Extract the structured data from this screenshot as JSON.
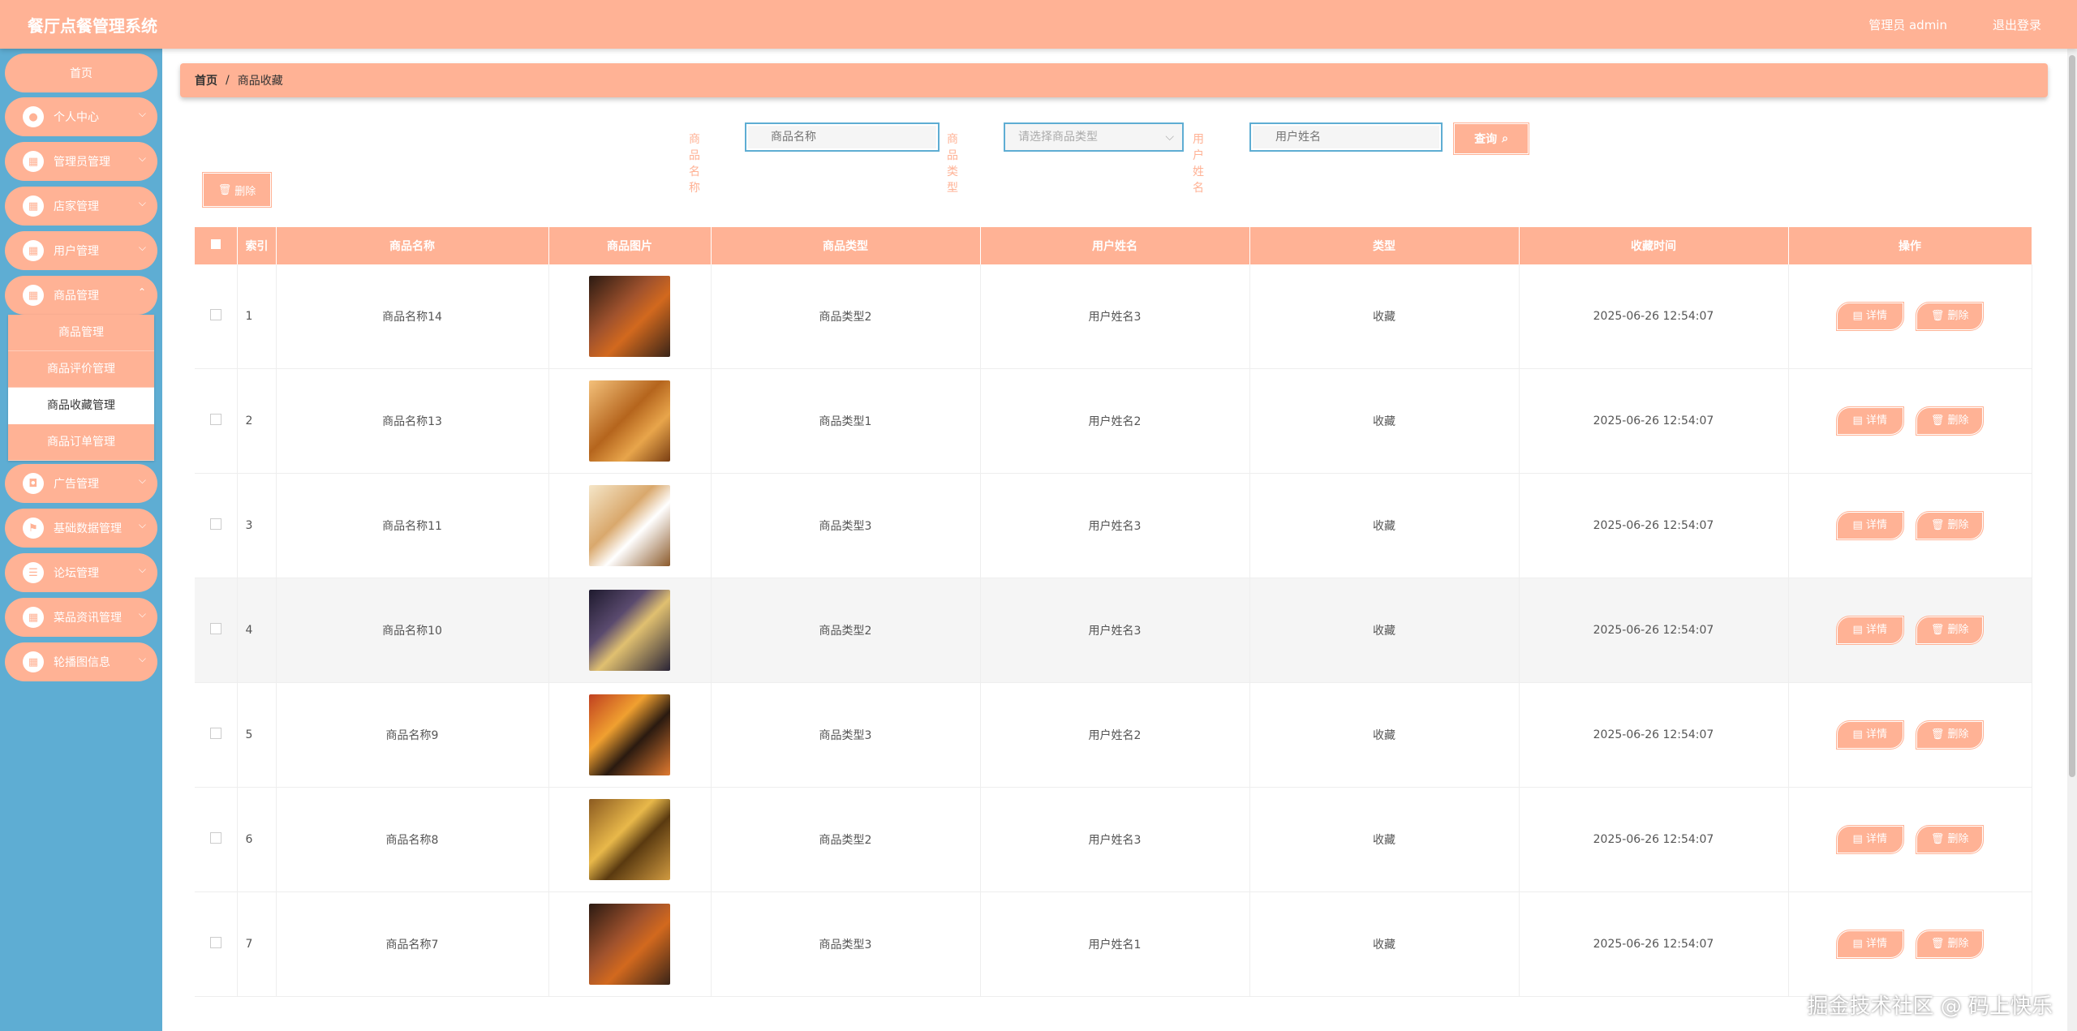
{
  "header": {
    "title": "餐厅点餐管理系统",
    "admin": "管理员 admin",
    "logout": "退出登录"
  },
  "sidebar": {
    "home": "首页",
    "items": [
      {
        "label": "个人中心",
        "icon": "user-icon"
      },
      {
        "label": "管理员管理",
        "icon": "grid-icon"
      },
      {
        "label": "店家管理",
        "icon": "grid-icon"
      },
      {
        "label": "用户管理",
        "icon": "grid-icon"
      },
      {
        "label": "商品管理",
        "icon": "grid-icon"
      },
      {
        "label": "广告管理",
        "icon": "bag-icon"
      },
      {
        "label": "基础数据管理",
        "icon": "flag-icon"
      },
      {
        "label": "论坛管理",
        "icon": "sliders-icon"
      },
      {
        "label": "菜品资讯管理",
        "icon": "grid-icon"
      },
      {
        "label": "轮播图信息",
        "icon": "grid-icon"
      }
    ],
    "submenu": [
      "商品管理",
      "商品评价管理",
      "商品收藏管理",
      "商品订单管理"
    ],
    "submenu_active": "商品收藏管理"
  },
  "breadcrumb": {
    "home": "首页",
    "sep": "/",
    "current": "商品收藏"
  },
  "search": {
    "name_label": "商品名称",
    "name_placeholder": "商品名称",
    "type_label": "商品类型",
    "type_placeholder": "请选择商品类型",
    "user_label": "用户姓名",
    "user_placeholder": "用户姓名",
    "query_label": "查询"
  },
  "toolbar": {
    "delete_label": "删除"
  },
  "table": {
    "headers": [
      "索引",
      "商品名称",
      "商品图片",
      "商品类型",
      "用户姓名",
      "类型",
      "收藏时间",
      "操作"
    ],
    "detail_label": "详情",
    "delete_label": "删除",
    "rows": [
      {
        "idx": "1",
        "name": "商品名称14",
        "type": "商品类型2",
        "user": "用户姓名3",
        "kind": "收藏",
        "time": "2025-06-26 12:54:07"
      },
      {
        "idx": "2",
        "name": "商品名称13",
        "type": "商品类型1",
        "user": "用户姓名2",
        "kind": "收藏",
        "time": "2025-06-26 12:54:07"
      },
      {
        "idx": "3",
        "name": "商品名称11",
        "type": "商品类型3",
        "user": "用户姓名3",
        "kind": "收藏",
        "time": "2025-06-26 12:54:07"
      },
      {
        "idx": "4",
        "name": "商品名称10",
        "type": "商品类型2",
        "user": "用户姓名3",
        "kind": "收藏",
        "time": "2025-06-26 12:54:07"
      },
      {
        "idx": "5",
        "name": "商品名称9",
        "type": "商品类型3",
        "user": "用户姓名2",
        "kind": "收藏",
        "time": "2025-06-26 12:54:07"
      },
      {
        "idx": "6",
        "name": "商品名称8",
        "type": "商品类型2",
        "user": "用户姓名3",
        "kind": "收藏",
        "time": "2025-06-26 12:54:07"
      },
      {
        "idx": "7",
        "name": "商品名称7",
        "type": "商品类型3",
        "user": "用户姓名1",
        "kind": "收藏",
        "time": "2025-06-26 12:54:07"
      }
    ]
  },
  "watermark": "掘金技术社区 @ 码上快乐",
  "colors": {
    "accent": "#ffb295",
    "sidebar": "#5eadd3"
  }
}
